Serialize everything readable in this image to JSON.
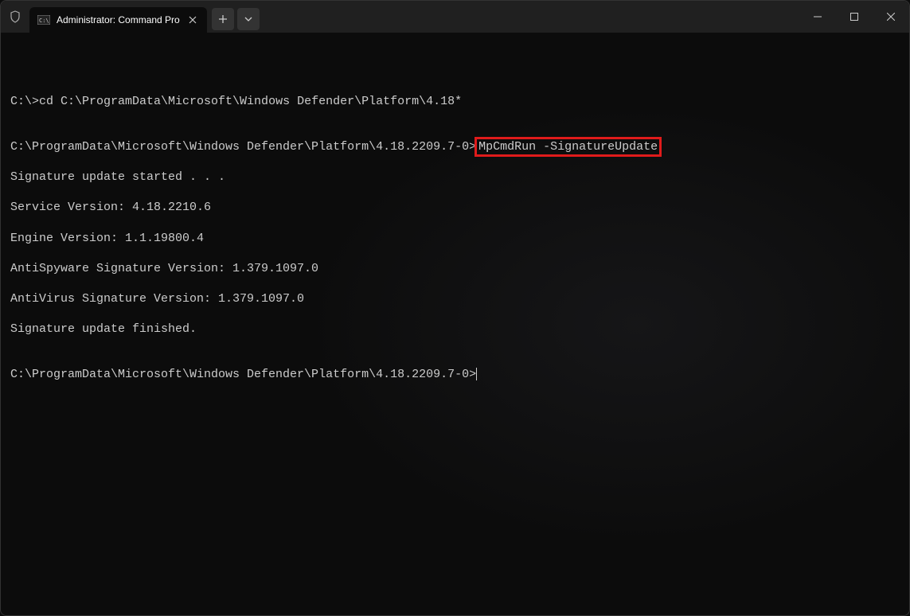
{
  "window": {
    "tab_title": "Administrator: Command Pro"
  },
  "terminal": {
    "line1_prompt": "C:\\>",
    "line1_cmd": "cd C:\\ProgramData\\Microsoft\\Windows Defender\\Platform\\4.18*",
    "line2_prompt": "C:\\ProgramData\\Microsoft\\Windows Defender\\Platform\\4.18.2209.7-0>",
    "line2_cmd": "MpCmdRun -SignatureUpdate",
    "output1": "Signature update started . . .",
    "output2": "Service Version: 4.18.2210.6",
    "output3": "Engine Version: 1.1.19800.4",
    "output4": "AntiSpyware Signature Version: 1.379.1097.0",
    "output5": "AntiVirus Signature Version: 1.379.1097.0",
    "output6": "Signature update finished.",
    "line3_prompt": "C:\\ProgramData\\Microsoft\\Windows Defender\\Platform\\4.18.2209.7-0>"
  }
}
